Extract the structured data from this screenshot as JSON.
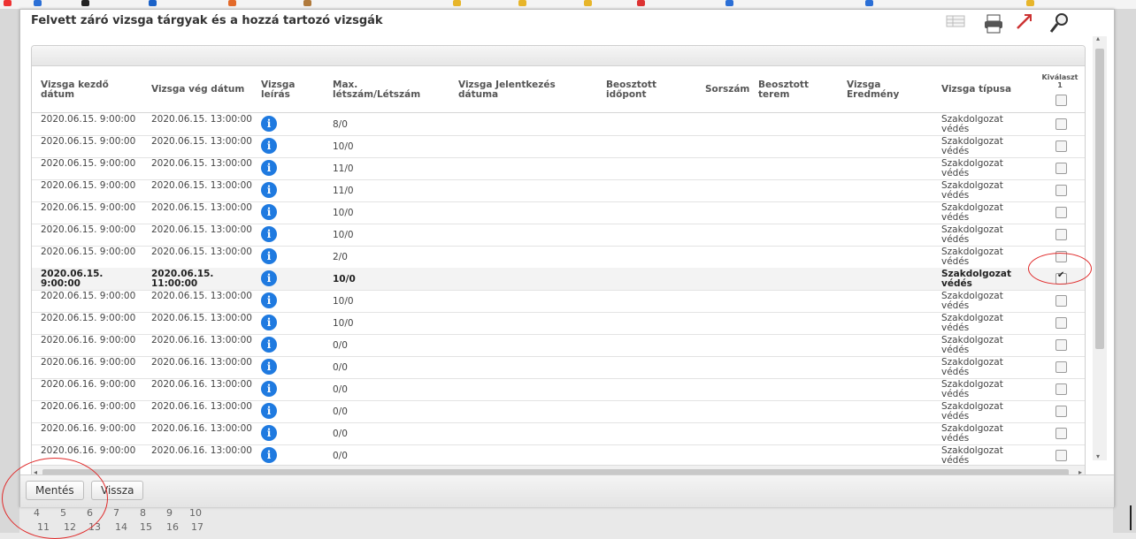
{
  "dialog": {
    "title": "Felvett záró vizsga tárgyak és a hozzá tartozó vizsgák"
  },
  "grid": {
    "columns": {
      "start": [
        "Vizsga kezdő",
        "dátum"
      ],
      "end": [
        "Vizsga vég dátum"
      ],
      "desc": [
        "Vizsga",
        "leírás"
      ],
      "max": [
        "Max.",
        "létszám/Létszám"
      ],
      "apply": [
        "Vizsga Jelentkezés",
        "dátuma"
      ],
      "slot": [
        "Beosztott",
        "időpont"
      ],
      "order": [
        "Sorszám"
      ],
      "room": [
        "Beosztott",
        "terem"
      ],
      "result": [
        "Vizsga",
        "Eredmény"
      ],
      "type": [
        "Vizsga típusa"
      ],
      "select": [
        "Kiválaszt",
        "1"
      ]
    },
    "rows": [
      {
        "start": "2020.06.15. 9:00:00",
        "end": "2020.06.15. 13:00:00",
        "max": "8/0",
        "type": "Szakdolgozat védés",
        "checked": false,
        "selected": false
      },
      {
        "start": "2020.06.15. 9:00:00",
        "end": "2020.06.15. 13:00:00",
        "max": "10/0",
        "type": "Szakdolgozat védés",
        "checked": false,
        "selected": false
      },
      {
        "start": "2020.06.15. 9:00:00",
        "end": "2020.06.15. 13:00:00",
        "max": "11/0",
        "type": "Szakdolgozat védés",
        "checked": false,
        "selected": false
      },
      {
        "start": "2020.06.15. 9:00:00",
        "end": "2020.06.15. 13:00:00",
        "max": "11/0",
        "type": "Szakdolgozat védés",
        "checked": false,
        "selected": false
      },
      {
        "start": "2020.06.15. 9:00:00",
        "end": "2020.06.15. 13:00:00",
        "max": "10/0",
        "type": "Szakdolgozat védés",
        "checked": false,
        "selected": false
      },
      {
        "start": "2020.06.15. 9:00:00",
        "end": "2020.06.15. 13:00:00",
        "max": "10/0",
        "type": "Szakdolgozat védés",
        "checked": false,
        "selected": false
      },
      {
        "start": "2020.06.15. 9:00:00",
        "end": "2020.06.15. 13:00:00",
        "max": "2/0",
        "type": "Szakdolgozat védés",
        "checked": false,
        "selected": false
      },
      {
        "start": "2020.06.15. 9:00:00",
        "end": "2020.06.15. 11:00:00",
        "max": "10/0",
        "type": "Szakdolgozat védés",
        "checked": true,
        "selected": true
      },
      {
        "start": "2020.06.15. 9:00:00",
        "end": "2020.06.15. 13:00:00",
        "max": "10/0",
        "type": "Szakdolgozat védés",
        "checked": false,
        "selected": false
      },
      {
        "start": "2020.06.15. 9:00:00",
        "end": "2020.06.15. 13:00:00",
        "max": "10/0",
        "type": "Szakdolgozat védés",
        "checked": false,
        "selected": false
      },
      {
        "start": "2020.06.16. 9:00:00",
        "end": "2020.06.16. 13:00:00",
        "max": "0/0",
        "type": "Szakdolgozat védés",
        "checked": false,
        "selected": false
      },
      {
        "start": "2020.06.16. 9:00:00",
        "end": "2020.06.16. 13:00:00",
        "max": "0/0",
        "type": "Szakdolgozat védés",
        "checked": false,
        "selected": false
      },
      {
        "start": "2020.06.16. 9:00:00",
        "end": "2020.06.16. 13:00:00",
        "max": "0/0",
        "type": "Szakdolgozat védés",
        "checked": false,
        "selected": false
      },
      {
        "start": "2020.06.16. 9:00:00",
        "end": "2020.06.16. 13:00:00",
        "max": "0/0",
        "type": "Szakdolgozat védés",
        "checked": false,
        "selected": false
      },
      {
        "start": "2020.06.16. 9:00:00",
        "end": "2020.06.16. 13:00:00",
        "max": "0/0",
        "type": "Szakdolgozat védés",
        "checked": false,
        "selected": false
      },
      {
        "start": "2020.06.16. 9:00:00",
        "end": "2020.06.16. 13:00:00",
        "max": "0/0",
        "type": "Szakdolgozat védés",
        "checked": false,
        "selected": false
      }
    ],
    "info_icon": "info-icon"
  },
  "footer": {
    "save_label": "Mentés",
    "back_label": "Vissza"
  },
  "background": {
    "pager_top": [
      "4",
      "5",
      "6",
      "7",
      "8",
      "9",
      "10"
    ],
    "pager_bottom": [
      "11",
      "12",
      "13",
      "14",
      "15",
      "16",
      "17"
    ]
  },
  "colors": {
    "info": "#1f7ae0",
    "annotation": "#e02a2a"
  }
}
